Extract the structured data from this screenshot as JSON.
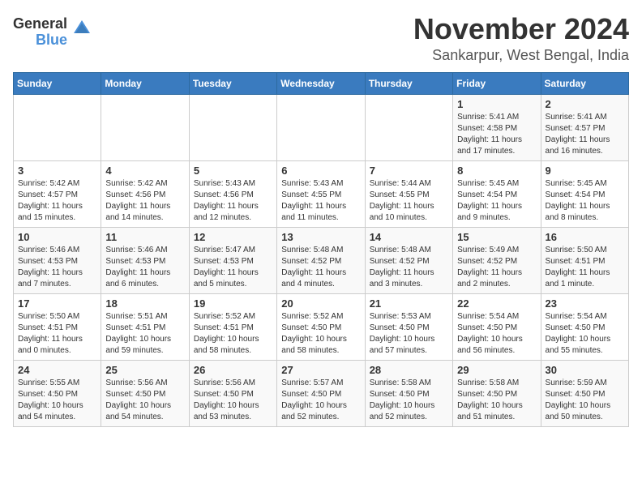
{
  "logo": {
    "general": "General",
    "blue": "Blue"
  },
  "title": "November 2024",
  "location": "Sankarpur, West Bengal, India",
  "days_of_week": [
    "Sunday",
    "Monday",
    "Tuesday",
    "Wednesday",
    "Thursday",
    "Friday",
    "Saturday"
  ],
  "weeks": [
    [
      {
        "day": "",
        "content": ""
      },
      {
        "day": "",
        "content": ""
      },
      {
        "day": "",
        "content": ""
      },
      {
        "day": "",
        "content": ""
      },
      {
        "day": "",
        "content": ""
      },
      {
        "day": "1",
        "content": "Sunrise: 5:41 AM\nSunset: 4:58 PM\nDaylight: 11 hours\nand 17 minutes."
      },
      {
        "day": "2",
        "content": "Sunrise: 5:41 AM\nSunset: 4:57 PM\nDaylight: 11 hours\nand 16 minutes."
      }
    ],
    [
      {
        "day": "3",
        "content": "Sunrise: 5:42 AM\nSunset: 4:57 PM\nDaylight: 11 hours\nand 15 minutes."
      },
      {
        "day": "4",
        "content": "Sunrise: 5:42 AM\nSunset: 4:56 PM\nDaylight: 11 hours\nand 14 minutes."
      },
      {
        "day": "5",
        "content": "Sunrise: 5:43 AM\nSunset: 4:56 PM\nDaylight: 11 hours\nand 12 minutes."
      },
      {
        "day": "6",
        "content": "Sunrise: 5:43 AM\nSunset: 4:55 PM\nDaylight: 11 hours\nand 11 minutes."
      },
      {
        "day": "7",
        "content": "Sunrise: 5:44 AM\nSunset: 4:55 PM\nDaylight: 11 hours\nand 10 minutes."
      },
      {
        "day": "8",
        "content": "Sunrise: 5:45 AM\nSunset: 4:54 PM\nDaylight: 11 hours\nand 9 minutes."
      },
      {
        "day": "9",
        "content": "Sunrise: 5:45 AM\nSunset: 4:54 PM\nDaylight: 11 hours\nand 8 minutes."
      }
    ],
    [
      {
        "day": "10",
        "content": "Sunrise: 5:46 AM\nSunset: 4:53 PM\nDaylight: 11 hours\nand 7 minutes."
      },
      {
        "day": "11",
        "content": "Sunrise: 5:46 AM\nSunset: 4:53 PM\nDaylight: 11 hours\nand 6 minutes."
      },
      {
        "day": "12",
        "content": "Sunrise: 5:47 AM\nSunset: 4:53 PM\nDaylight: 11 hours\nand 5 minutes."
      },
      {
        "day": "13",
        "content": "Sunrise: 5:48 AM\nSunset: 4:52 PM\nDaylight: 11 hours\nand 4 minutes."
      },
      {
        "day": "14",
        "content": "Sunrise: 5:48 AM\nSunset: 4:52 PM\nDaylight: 11 hours\nand 3 minutes."
      },
      {
        "day": "15",
        "content": "Sunrise: 5:49 AM\nSunset: 4:52 PM\nDaylight: 11 hours\nand 2 minutes."
      },
      {
        "day": "16",
        "content": "Sunrise: 5:50 AM\nSunset: 4:51 PM\nDaylight: 11 hours\nand 1 minute."
      }
    ],
    [
      {
        "day": "17",
        "content": "Sunrise: 5:50 AM\nSunset: 4:51 PM\nDaylight: 11 hours\nand 0 minutes."
      },
      {
        "day": "18",
        "content": "Sunrise: 5:51 AM\nSunset: 4:51 PM\nDaylight: 10 hours\nand 59 minutes."
      },
      {
        "day": "19",
        "content": "Sunrise: 5:52 AM\nSunset: 4:51 PM\nDaylight: 10 hours\nand 58 minutes."
      },
      {
        "day": "20",
        "content": "Sunrise: 5:52 AM\nSunset: 4:50 PM\nDaylight: 10 hours\nand 58 minutes."
      },
      {
        "day": "21",
        "content": "Sunrise: 5:53 AM\nSunset: 4:50 PM\nDaylight: 10 hours\nand 57 minutes."
      },
      {
        "day": "22",
        "content": "Sunrise: 5:54 AM\nSunset: 4:50 PM\nDaylight: 10 hours\nand 56 minutes."
      },
      {
        "day": "23",
        "content": "Sunrise: 5:54 AM\nSunset: 4:50 PM\nDaylight: 10 hours\nand 55 minutes."
      }
    ],
    [
      {
        "day": "24",
        "content": "Sunrise: 5:55 AM\nSunset: 4:50 PM\nDaylight: 10 hours\nand 54 minutes."
      },
      {
        "day": "25",
        "content": "Sunrise: 5:56 AM\nSunset: 4:50 PM\nDaylight: 10 hours\nand 54 minutes."
      },
      {
        "day": "26",
        "content": "Sunrise: 5:56 AM\nSunset: 4:50 PM\nDaylight: 10 hours\nand 53 minutes."
      },
      {
        "day": "27",
        "content": "Sunrise: 5:57 AM\nSunset: 4:50 PM\nDaylight: 10 hours\nand 52 minutes."
      },
      {
        "day": "28",
        "content": "Sunrise: 5:58 AM\nSunset: 4:50 PM\nDaylight: 10 hours\nand 52 minutes."
      },
      {
        "day": "29",
        "content": "Sunrise: 5:58 AM\nSunset: 4:50 PM\nDaylight: 10 hours\nand 51 minutes."
      },
      {
        "day": "30",
        "content": "Sunrise: 5:59 AM\nSunset: 4:50 PM\nDaylight: 10 hours\nand 50 minutes."
      }
    ]
  ]
}
